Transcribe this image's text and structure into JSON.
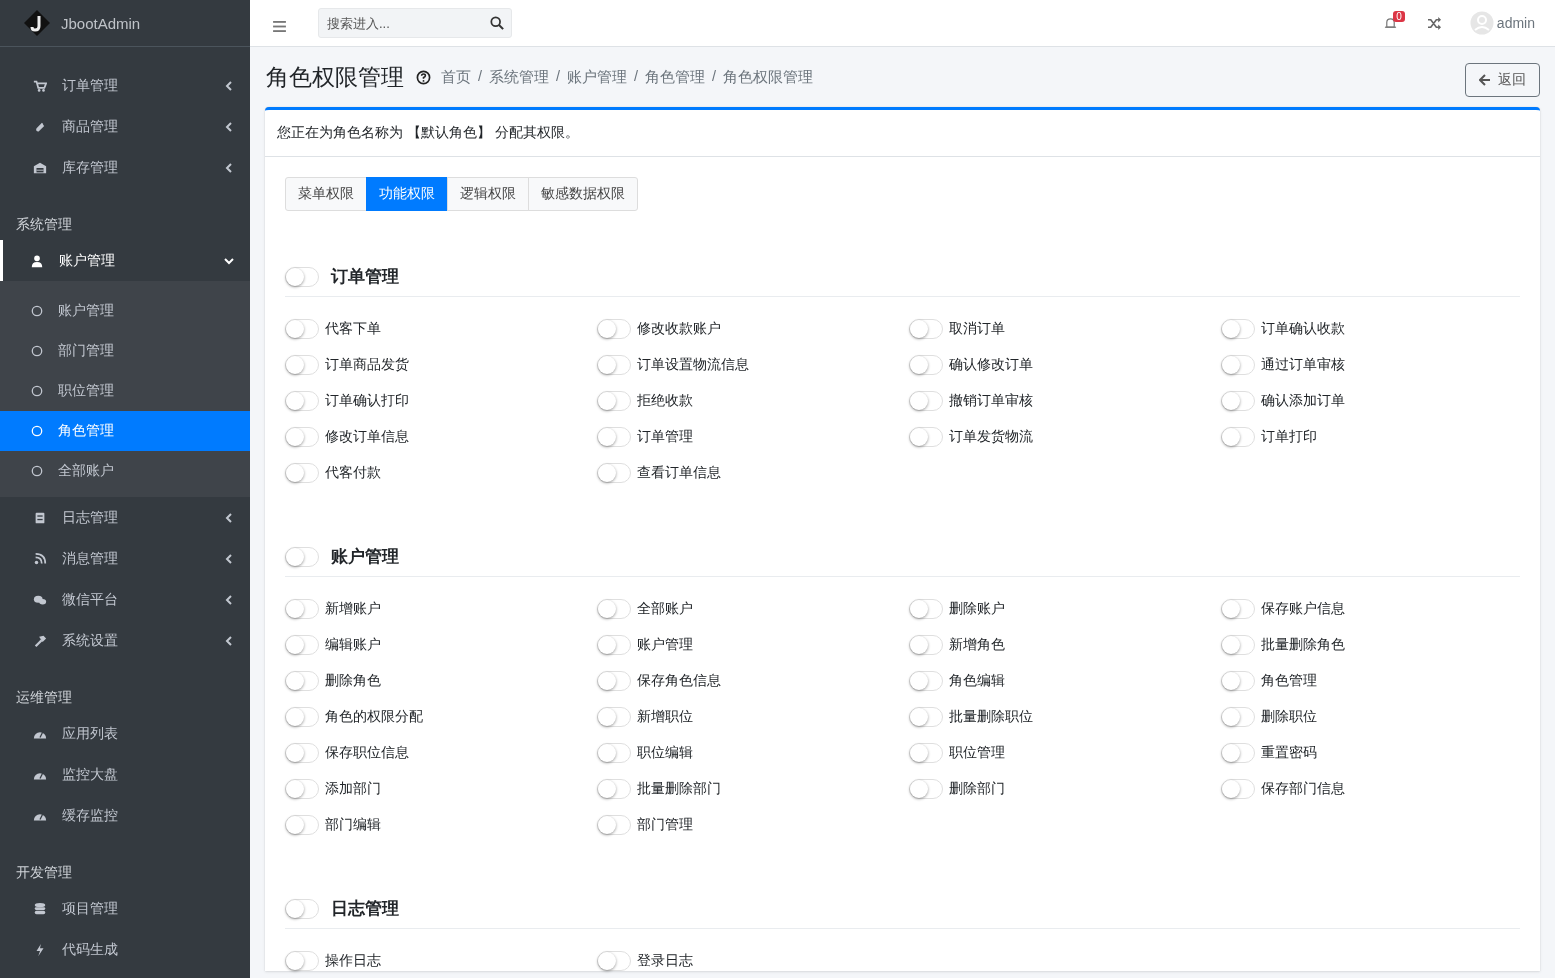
{
  "sidebar": {
    "brand": "JbootAdmin",
    "groups": [
      {
        "items": [
          {
            "label": "订单管理",
            "kind": "submenu",
            "expanded": false
          },
          {
            "label": "商品管理",
            "kind": "submenu",
            "expanded": false
          },
          {
            "label": "库存管理",
            "kind": "submenu",
            "expanded": false
          }
        ]
      },
      {
        "header": "系统管理",
        "items": [
          {
            "label": "账户管理",
            "kind": "submenu",
            "expanded": true,
            "children": [
              {
                "label": "账户管理",
                "selected": false
              },
              {
                "label": "部门管理",
                "selected": false
              },
              {
                "label": "职位管理",
                "selected": false
              },
              {
                "label": "角色管理",
                "selected": true
              },
              {
                "label": "全部账户",
                "selected": false
              }
            ]
          },
          {
            "label": "日志管理",
            "kind": "submenu",
            "expanded": false
          },
          {
            "label": "消息管理",
            "kind": "submenu",
            "expanded": false
          },
          {
            "label": "微信平台",
            "kind": "submenu",
            "expanded": false
          },
          {
            "label": "系统设置",
            "kind": "submenu",
            "expanded": false
          }
        ]
      },
      {
        "header": "运维管理",
        "items": [
          {
            "label": "应用列表",
            "kind": "link"
          },
          {
            "label": "监控大盘",
            "kind": "link"
          },
          {
            "label": "缓存监控",
            "kind": "link"
          }
        ]
      },
      {
        "header": "开发管理",
        "items": [
          {
            "label": "项目管理",
            "kind": "link"
          },
          {
            "label": "代码生成",
            "kind": "link"
          }
        ]
      }
    ]
  },
  "topbar": {
    "search": {
      "placeholder": "搜索进入..."
    },
    "notifications": "0",
    "user": "admin"
  },
  "page": {
    "title": "角色权限管理",
    "breadcrumbs": [
      "首页",
      "系统管理",
      "账户管理",
      "角色管理",
      "角色权限管理"
    ],
    "breadcrumb_separators": [
      "/",
      "/",
      "/",
      "/"
    ],
    "back_button": "返回"
  },
  "card": {
    "notice": "您正在为角色名称为 【默认角色】 分配其权限。",
    "tabs": [
      {
        "label": "菜单权限",
        "selected": false
      },
      {
        "label": "功能权限",
        "selected": true
      },
      {
        "label": "逻辑权限",
        "selected": false
      },
      {
        "label": "敏感数据权限",
        "selected": false
      }
    ],
    "sections": [
      {
        "title": "订单管理",
        "on": false,
        "permissions": [
          {
            "label": "代客下单",
            "on": false
          },
          {
            "label": "修改收款账户",
            "on": false
          },
          {
            "label": "取消订单",
            "on": false
          },
          {
            "label": "订单确认收款",
            "on": false
          },
          {
            "label": "订单商品发货",
            "on": false
          },
          {
            "label": "订单设置物流信息",
            "on": false
          },
          {
            "label": "确认修改订单",
            "on": false
          },
          {
            "label": "通过订单审核",
            "on": false
          },
          {
            "label": "订单确认打印",
            "on": false
          },
          {
            "label": "拒绝收款",
            "on": false
          },
          {
            "label": "撤销订单审核",
            "on": false
          },
          {
            "label": "确认添加订单",
            "on": false
          },
          {
            "label": "修改订单信息",
            "on": false
          },
          {
            "label": "订单管理",
            "on": false
          },
          {
            "label": "订单发货物流",
            "on": false
          },
          {
            "label": "订单打印",
            "on": false
          },
          {
            "label": "代客付款",
            "on": false
          },
          {
            "label": "查看订单信息",
            "on": false
          }
        ]
      },
      {
        "title": "账户管理",
        "on": false,
        "permissions": [
          {
            "label": "新增账户",
            "on": false
          },
          {
            "label": "全部账户",
            "on": false
          },
          {
            "label": "删除账户",
            "on": false
          },
          {
            "label": "保存账户信息",
            "on": false
          },
          {
            "label": "编辑账户",
            "on": false
          },
          {
            "label": "账户管理",
            "on": false
          },
          {
            "label": "新增角色",
            "on": false
          },
          {
            "label": "批量删除角色",
            "on": false
          },
          {
            "label": "删除角色",
            "on": false
          },
          {
            "label": "保存角色信息",
            "on": false
          },
          {
            "label": "角色编辑",
            "on": false
          },
          {
            "label": "角色管理",
            "on": false
          },
          {
            "label": "角色的权限分配",
            "on": false
          },
          {
            "label": "新增职位",
            "on": false
          },
          {
            "label": "批量删除职位",
            "on": false
          },
          {
            "label": "删除职位",
            "on": false
          },
          {
            "label": "保存职位信息",
            "on": false
          },
          {
            "label": "职位编辑",
            "on": false
          },
          {
            "label": "职位管理",
            "on": false
          },
          {
            "label": "重置密码",
            "on": false
          },
          {
            "label": "添加部门",
            "on": false
          },
          {
            "label": "批量删除部门",
            "on": false
          },
          {
            "label": "删除部门",
            "on": false
          },
          {
            "label": "保存部门信息",
            "on": false
          },
          {
            "label": "部门编辑",
            "on": false
          },
          {
            "label": "部门管理",
            "on": false
          }
        ]
      },
      {
        "title": "日志管理",
        "on": false,
        "permissions": [
          {
            "label": "操作日志",
            "on": false
          },
          {
            "label": "登录日志",
            "on": false
          }
        ]
      }
    ]
  }
}
